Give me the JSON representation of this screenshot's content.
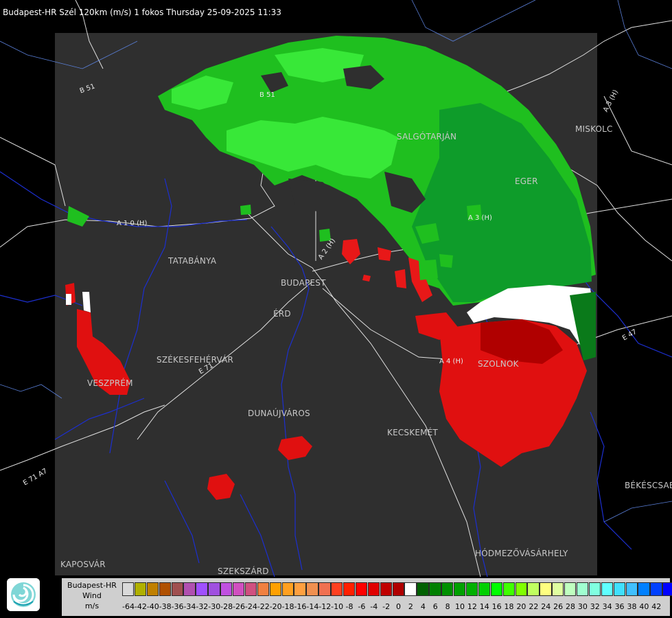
{
  "title": "Budapest-HR Szél 120km (m/s) 1 fokos Thursday 25-09-2025 11:33",
  "cities": [
    {
      "name": "TATABÁNYA",
      "key": "tatabanya"
    },
    {
      "name": "BUDAPEST",
      "key": "budapest"
    },
    {
      "name": "ÉRD",
      "key": "erd"
    },
    {
      "name": "SZÉKESFEHÉRVÁR",
      "key": "szekesfehervar"
    },
    {
      "name": "VESZPRÉM",
      "key": "veszprem"
    },
    {
      "name": "DUNAÚJVÁROS",
      "key": "dunaujvaros"
    },
    {
      "name": "KECSKEMÉT",
      "key": "kecskemet"
    },
    {
      "name": "SZOLNOK",
      "key": "szolnok"
    },
    {
      "name": "SALGÓTARJÁN",
      "key": "salgotarjan"
    },
    {
      "name": "EGER",
      "key": "eger"
    },
    {
      "name": "MISKOLC",
      "key": "miskolc"
    },
    {
      "name": "BÉKÉSCSABA",
      "key": "bekescsaba"
    },
    {
      "name": "HÓDMEZŐVÁSÁRHELY",
      "key": "hodmezovasarhely"
    },
    {
      "name": "SZEKSZÁRD",
      "key": "szekszard"
    },
    {
      "name": "KAPOSVÁR",
      "key": "kaposvar"
    }
  ],
  "roads": [
    "B 51",
    "B 51",
    "A 1 0 (H)",
    "A 2 (H)",
    "A 3 (H)",
    "A 3 (H)",
    "A 4 (H)",
    "E 47",
    "E 71",
    "E 71 A7"
  ],
  "legend": {
    "title_lines": [
      "Budapest-HR",
      "Wind",
      "m/s"
    ],
    "colors": [
      "#d9d9d9",
      "#b0b000",
      "#c08000",
      "#b05000",
      "#a05050",
      "#b050b0",
      "#a050ff",
      "#a050e0",
      "#c050e0",
      "#d050c0",
      "#d05080",
      "#f08040",
      "#ffa000",
      "#ffa020",
      "#ffa040",
      "#f09050",
      "#f07050",
      "#ff4020",
      "#ff2000",
      "#ff0000",
      "#e00000",
      "#c00000",
      "#b00000",
      "#ffffff",
      "#006000",
      "#008000",
      "#009000",
      "#00a000",
      "#00b000",
      "#00d000",
      "#00ff00",
      "#40ff00",
      "#80ff00",
      "#c0ff60",
      "#ffff80",
      "#e0ffa0",
      "#c0ffc0",
      "#a0ffd0",
      "#80ffe0",
      "#60ffff",
      "#40e0ff",
      "#40c0ff",
      "#0080ff",
      "#0040ff",
      "#0000ff"
    ],
    "ticks": [
      "-64",
      "-42",
      "-40",
      "-38",
      "-36",
      "-34",
      "-32",
      "-30",
      "-28",
      "-26",
      "-24",
      "-22",
      "-20",
      "-18",
      "-16",
      "-14",
      "-12",
      "-10",
      "-8",
      "-6",
      "-4",
      "-2",
      "0",
      "2",
      "4",
      "6",
      "8",
      "10",
      "12",
      "14",
      "16",
      "18",
      "20",
      "22",
      "24",
      "26",
      "28",
      "30",
      "32",
      "34",
      "36",
      "38",
      "40",
      "42"
    ]
  },
  "logo_icon": "omsz-spiral-logo-icon"
}
